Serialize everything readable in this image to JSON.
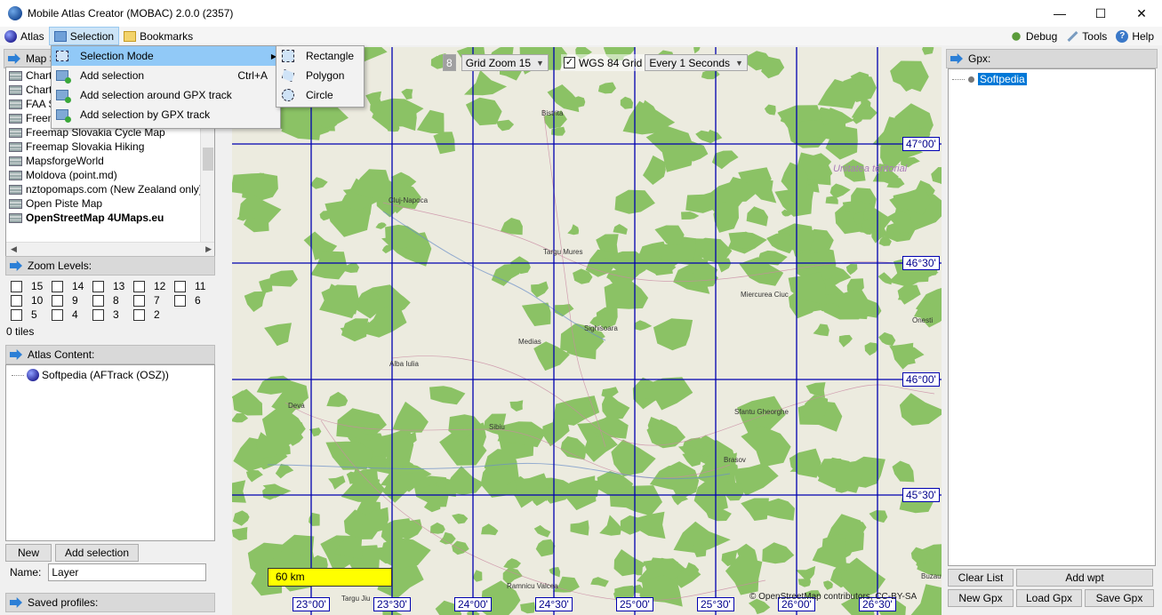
{
  "window": {
    "title": "Mobile Atlas Creator (MOBAC) 2.0.0 (2357)",
    "minimize": "—",
    "maximize": "☐",
    "close": "✕"
  },
  "menubar": {
    "atlas": "Atlas",
    "selection": "Selection",
    "bookmarks": "Bookmarks",
    "debug": "Debug",
    "tools": "Tools",
    "help": "Help"
  },
  "selection_menu": {
    "items": [
      {
        "label": "Selection Mode",
        "shortcut": "",
        "has_submenu": true,
        "icon": "selection-mode-icon"
      },
      {
        "label": "Add selection",
        "shortcut": "Ctrl+A",
        "icon": "add-selection-icon"
      },
      {
        "label": "Add selection around GPX track",
        "shortcut": "",
        "icon": "add-selection-gpx-icon"
      },
      {
        "label": "Add selection by GPX track",
        "shortcut": "",
        "icon": "add-selection-by-gpx-icon"
      }
    ]
  },
  "selection_mode_submenu": {
    "items": [
      {
        "label": "Rectangle",
        "icon": "rectangle-icon"
      },
      {
        "label": "Polygon",
        "icon": "polygon-icon"
      },
      {
        "label": "Circle",
        "icon": "circle-icon"
      }
    ]
  },
  "map_source": {
    "header": "Map S",
    "items": [
      {
        "label": "Chart"
      },
      {
        "label": "Chart"
      },
      {
        "label": "FAA S"
      },
      {
        "label": "Freem"
      },
      {
        "label": "Freemap Slovakia Cycle Map"
      },
      {
        "label": "Freemap Slovakia Hiking"
      },
      {
        "label": "MapsforgeWorld"
      },
      {
        "label": "Moldova (point.md)"
      },
      {
        "label": "nztopomaps.com (New Zealand only)"
      },
      {
        "label": "Open Piste Map"
      },
      {
        "label": "OpenStreetMap 4UMaps.eu",
        "selected": true
      }
    ]
  },
  "zoom_levels": {
    "header": "Zoom Levels:",
    "levels": [
      "15",
      "14",
      "13",
      "12",
      "11",
      "10",
      "9",
      "8",
      "7",
      "6",
      "5",
      "4",
      "3",
      "2"
    ],
    "tiles": "0 tiles"
  },
  "atlas_content": {
    "header": "Atlas Content:",
    "node": "Softpedia (AFTrack (OSZ))",
    "new_button": "New",
    "add_selection_button": "Add selection",
    "name_label": "Name:",
    "name_value": "Layer"
  },
  "saved_profiles": {
    "header": "Saved profiles:"
  },
  "map_toolbar": {
    "zoom_box": "8",
    "grid_zoom": "Grid Zoom 15",
    "wgs_grid": "WGS 84 Grid",
    "interval": "Every 1 Seconds"
  },
  "map": {
    "lat_labels": [
      "47°00'",
      "46°30'",
      "46°00'",
      "45°30'"
    ],
    "lon_labels": [
      "23°00'",
      "23°30'",
      "24°00'",
      "24°30'",
      "25°00'",
      "25°30'",
      "26°00'",
      "26°30'"
    ],
    "places": [
      "Bistrita",
      "Cluj-Napoca",
      "Targu Mures",
      "Miercurea Ciuc",
      "Medias",
      "Sighisoara",
      "Onesti",
      "Alba Iulia",
      "Deva",
      "Sibiu",
      "Sfantu Gheorghe",
      "Brasov",
      "Ramnicu Valcea",
      "Targu Jiu",
      "Buzau",
      "Unitatea teritorial"
    ],
    "scale": "60 km",
    "attribution": "© OpenStreetMap contributors, CC-BY-SA"
  },
  "gpx_panel": {
    "header": "Gpx:",
    "node": "Softpedia",
    "clear_list": "Clear List",
    "add_wpt": "Add wpt",
    "new_gpx": "New Gpx",
    "load_gpx": "Load Gpx",
    "save_gpx": "Save Gpx"
  },
  "colors": {
    "forest": "#7dbb58",
    "grid_line": "#0000b0",
    "selection_highlight": "#91c9f7",
    "scale_bar": "#ffff00"
  }
}
